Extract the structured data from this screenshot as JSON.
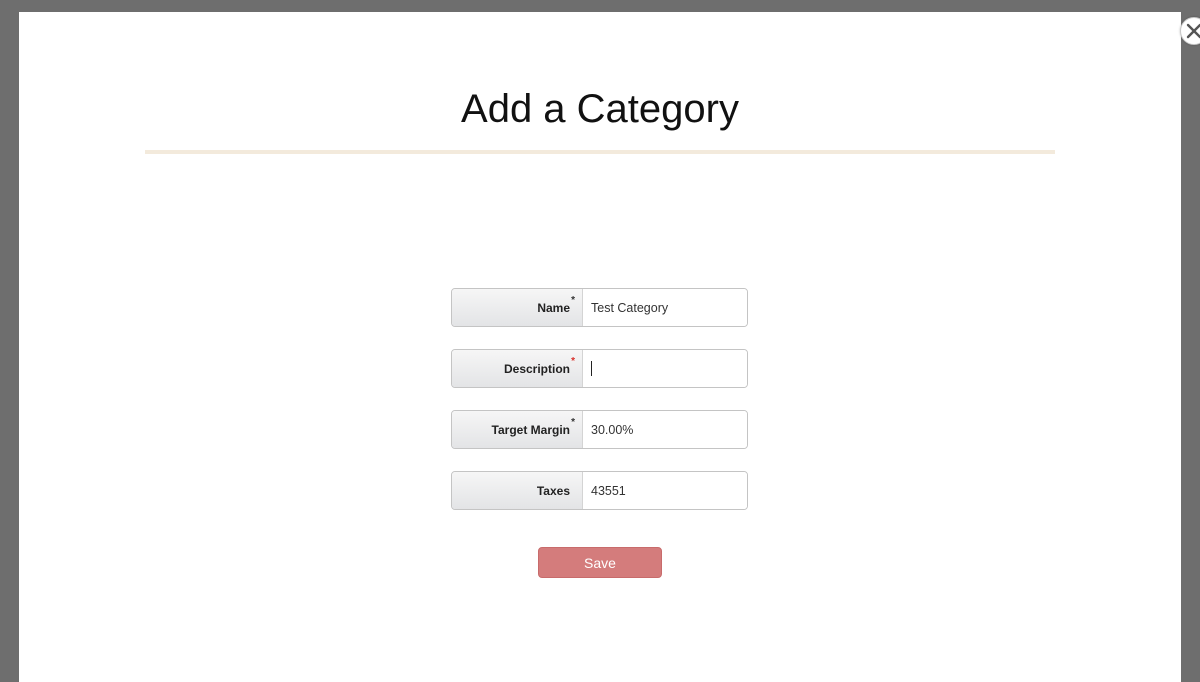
{
  "modal": {
    "title": "Add a Category",
    "close_icon": "close-icon"
  },
  "form": {
    "fields": [
      {
        "label": "Name",
        "required_marker": "*",
        "value": "Test Category"
      },
      {
        "label": "Description",
        "required_marker": "*",
        "value": ""
      },
      {
        "label": "Target Margin",
        "required_marker": "*",
        "value": "30.00%"
      },
      {
        "label": "Taxes",
        "required_marker": "",
        "value": "43551"
      }
    ],
    "save_label": "Save"
  },
  "colors": {
    "overlay": "#6e6e6e",
    "save_button": "#d47c7c",
    "divider": "#f3eadc",
    "required_marker_invalid": "#d9302c"
  }
}
